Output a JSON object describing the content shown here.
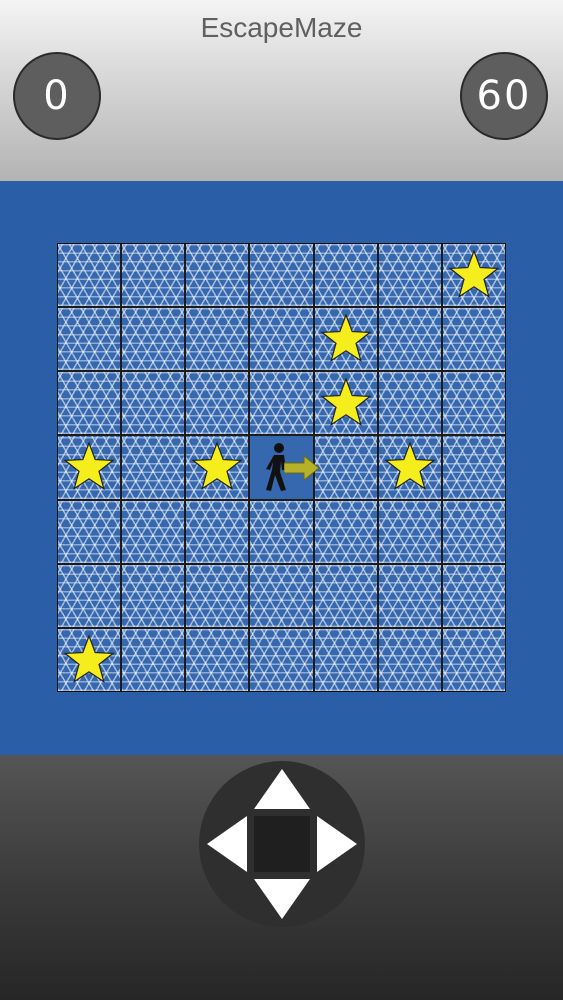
{
  "app": {
    "title": "EscapeMaze"
  },
  "hud": {
    "score": "0",
    "timer": "60"
  },
  "board": {
    "rows": 7,
    "cols": 7,
    "stars": [
      {
        "row": 0,
        "col": 6
      },
      {
        "row": 1,
        "col": 4
      },
      {
        "row": 2,
        "col": 4
      },
      {
        "row": 3,
        "col": 0
      },
      {
        "row": 3,
        "col": 2
      },
      {
        "row": 3,
        "col": 5
      },
      {
        "row": 6,
        "col": 0
      }
    ],
    "player": {
      "row": 3,
      "col": 3,
      "facing": "right"
    }
  },
  "controls": {
    "buttons": [
      "up",
      "down",
      "left",
      "right"
    ]
  },
  "colors": {
    "board_background": "#2a5ea6",
    "tile": "#3668b0",
    "star": "#f5ee1c",
    "arrow": "#b5b22a"
  }
}
